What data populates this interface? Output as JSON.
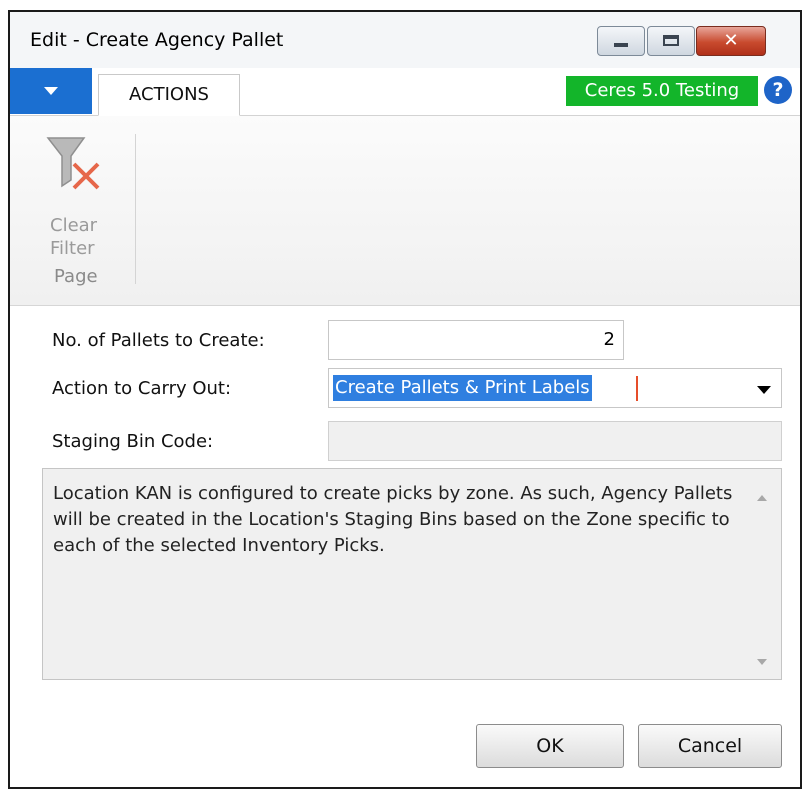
{
  "window": {
    "title": "Edit - Create Agency Pallet",
    "close_glyph": "✕"
  },
  "ribbon": {
    "tab_label": "ACTIONS",
    "environment_badge": "Ceres 5.0 Testing",
    "help_glyph": "?",
    "clear_filter_label": "Clear Filter",
    "group_label": "Page"
  },
  "form": {
    "pallets_label": "No. of Pallets to Create:",
    "pallets_value": "2",
    "action_label": "Action to Carry Out:",
    "action_value": "Create Pallets & Print Labels",
    "staging_label": "Staging Bin Code:",
    "staging_value": ""
  },
  "info": {
    "text": "Location KAN is configured to create picks by zone. As such, Agency Pallets will be created in the Location's Staging Bins based on the Zone specific to each of the selected Inventory Picks."
  },
  "buttons": {
    "ok": "OK",
    "cancel": "Cancel"
  },
  "colors": {
    "app_menu": "#1b6fd1",
    "badge": "#13b52a",
    "selection": "#2f7fe0",
    "close_button": "#c84a2e"
  },
  "icons": {
    "filter": "clear-filter-icon",
    "help": "help-icon",
    "dropdown": "chevron-down-icon"
  }
}
